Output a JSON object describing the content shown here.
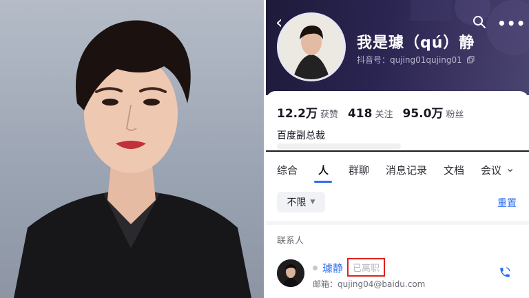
{
  "profile": {
    "name": "我是璩（qú）静",
    "douyin_id": "抖音号：qujing01qujing01"
  },
  "stats": [
    {
      "value": "12.2万",
      "label": "获赞"
    },
    {
      "value": "418",
      "label": "关注"
    },
    {
      "value": "95.0万",
      "label": "粉丝"
    }
  ],
  "bio": "百度副总裁",
  "tabs": [
    "综合",
    "人",
    "群聊",
    "消息记录",
    "文档",
    "会议"
  ],
  "active_tab": "人",
  "filter": {
    "label": "不限",
    "reset": "重置"
  },
  "contacts_section": {
    "label": "联系人"
  },
  "contact": {
    "name": "璩静",
    "status": "已离职",
    "email": "邮箱：qujing04@baidu.com"
  },
  "colors": {
    "accent": "#2f6df0",
    "highlight_box": "#e0211c",
    "header_bg": "#2b2552"
  },
  "icons": [
    "back-chevron-icon",
    "search-icon",
    "more-icon",
    "copy-icon",
    "chevron-down-icon",
    "caret-down-icon",
    "phone-icon"
  ]
}
